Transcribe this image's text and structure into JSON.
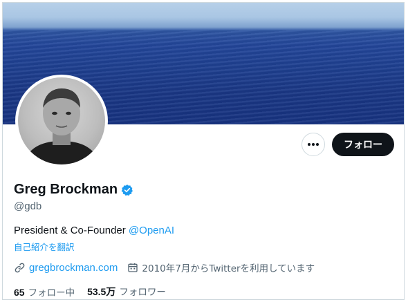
{
  "profile": {
    "display_name": "Greg Brockman",
    "handle": "@gdb",
    "bio_text": "President & Co-Founder ",
    "bio_mention": "@OpenAI",
    "translate_label": "自己紹介を翻訳",
    "website": "gregbrockman.com",
    "joined": "2010年7月からTwitterを利用しています",
    "verified": true
  },
  "actions": {
    "more_icon": "more-horizontal-icon",
    "follow_label": "フォロー"
  },
  "stats": {
    "following_count": "65",
    "following_label": "フォロー中",
    "followers_count": "53.5万",
    "followers_label": "フォロワー"
  },
  "colors": {
    "accent": "#1d9bf0",
    "text_primary": "#0f1419",
    "text_secondary": "#536471",
    "follow_button_bg": "#0f1419",
    "border": "#cfd9de"
  },
  "icons": {
    "verified": "verified-badge-icon",
    "link": "link-icon",
    "calendar": "calendar-icon"
  }
}
